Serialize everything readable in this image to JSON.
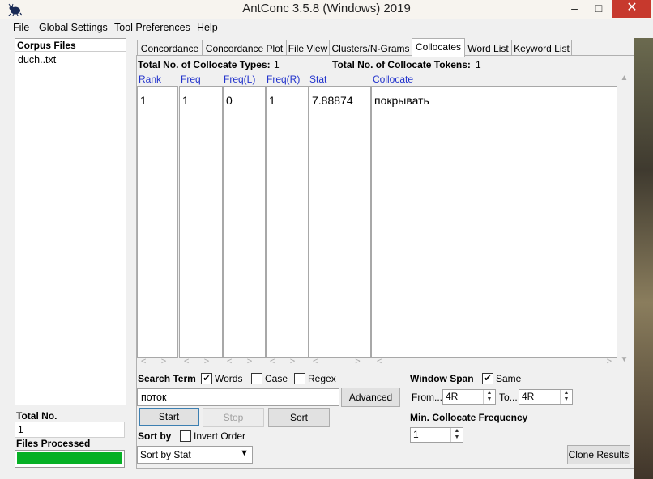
{
  "window": {
    "title": "AntConc 3.5.8 (Windows) 2019"
  },
  "window_controls": {
    "minimize": "–",
    "maximize": "□",
    "close": "✕"
  },
  "menu": [
    "File",
    "Global Settings",
    "Tool Preferences",
    "Help"
  ],
  "corpus": {
    "header": "Corpus Files",
    "files": [
      "duch..txt"
    ]
  },
  "total": {
    "label": "Total No.",
    "value": "1"
  },
  "files_processed": {
    "label": "Files Processed",
    "progress": 1.0
  },
  "tabs": [
    "Concordance",
    "Concordance Plot",
    "File View",
    "Clusters/N-Grams",
    "Collocates",
    "Word List",
    "Keyword List"
  ],
  "active_tab": "Collocates",
  "stats": {
    "types_label": "Total No. of Collocate Types:",
    "types_value": "1",
    "tokens_label": "Total No. of Collocate Tokens:",
    "tokens_value": "1"
  },
  "columns": [
    "Rank",
    "Freq",
    "Freq(L)",
    "Freq(R)",
    "Stat",
    "Collocate"
  ],
  "rows": [
    {
      "rank": "1",
      "freq": "1",
      "freq_l": "0",
      "freq_r": "1",
      "stat": "7.88874",
      "collocate": "покрывать"
    }
  ],
  "search": {
    "term_label": "Search Term",
    "words_label": "Words",
    "words_checked": true,
    "case_label": "Case",
    "case_checked": false,
    "regex_label": "Regex",
    "regex_checked": false,
    "value": "поток",
    "advanced_label": "Advanced",
    "start_label": "Start",
    "stop_label": "Stop",
    "sort_label": "Sort"
  },
  "sort": {
    "label": "Sort by",
    "invert_label": "Invert Order",
    "invert_checked": false,
    "selected": "Sort by Stat"
  },
  "window_span": {
    "label": "Window Span",
    "same_label": "Same",
    "same_checked": true,
    "from_label": "From...",
    "from_value": "4R",
    "to_label": "To...",
    "to_value": "4R"
  },
  "min_freq": {
    "label": "Min. Collocate Frequency",
    "value": "1"
  },
  "clone_label": "Clone Results",
  "colors": {
    "header_blue": "#2233cc",
    "progress_green": "#06b025",
    "close_red": "#c7392d"
  }
}
